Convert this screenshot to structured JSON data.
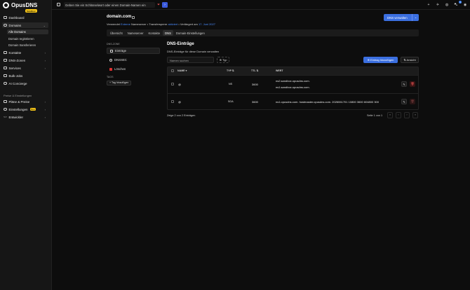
{
  "app": {
    "name": "OpusDNS",
    "env_badge": "Sandbox"
  },
  "topbar": {
    "search_placeholder": "Geben Sie ein Schlüsselwort oder einen Domain-Namen ein",
    "notification_count": "1"
  },
  "sidebar": {
    "items": [
      {
        "label": "Dashboard",
        "icon": "dashboard-icon"
      },
      {
        "label": "Domains",
        "icon": "globe-icon",
        "expanded": true
      },
      {
        "label": "Kontakte",
        "icon": "contacts-icon"
      },
      {
        "label": "DNS-Zonen",
        "icon": "dns-icon"
      },
      {
        "label": "Services",
        "icon": "services-icon"
      },
      {
        "label": "Bulk-Jobs",
        "icon": "bulk-icon"
      },
      {
        "label": "AI Concierge",
        "icon": "ai-icon"
      }
    ],
    "domain_sub": [
      "Alle Domains",
      "Domain registrieren",
      "Domain transferieren"
    ],
    "section_label": "Preise & Einstellungen",
    "bottom_items": [
      {
        "label": "Pläne & Preise",
        "icon": "plans-icon"
      },
      {
        "label": "Einstellungen",
        "icon": "settings-icon",
        "badge": "Neu"
      },
      {
        "label": "Entwickler",
        "icon": "code-icon"
      }
    ]
  },
  "domain": {
    "name": "domain.com",
    "meta_prefix": "Verwendet",
    "meta_link1": "Externe",
    "meta_mid": "Nameserver • Transfersperre",
    "meta_link2": "aktiviert",
    "meta_mid2": "• Verlängert am",
    "meta_date": "17. Juni 2027",
    "manage_button": "DNS verwalten"
  },
  "tabs": [
    "Übersicht",
    "Nameserver",
    "Kontakte",
    "DNS",
    "Domain-Einstellungen"
  ],
  "active_tab": "DNS",
  "dns_nav": {
    "label": "DNS-ZONE",
    "items": [
      "Einträge",
      "DNSSEC",
      "Löschen"
    ],
    "tags_label": "TAGS",
    "tag_button": "+ Tag hinzufügen"
  },
  "records": {
    "title": "DNS-Einträge",
    "description": "DNS-Einträge für diese Domain verwalten",
    "search_placeholder": "Namen suchen",
    "type_filter": "⊕ Typ",
    "add_button": "⊕ Eintrag hinzufügen",
    "view_button": "⇅ Ansicht",
    "columns": [
      "NAME ▾",
      "TYP ⇅",
      "TTL ⇅",
      "WERT"
    ],
    "rows": [
      {
        "name": "@",
        "type": "NS",
        "ttl": "3600",
        "values": [
          "ns2.sandbox.opusdns.com.",
          "ns1.sandbox.opusdns.com."
        ]
      },
      {
        "name": "@",
        "type": "SOA",
        "ttl": "3600",
        "values": [
          "ns1.opusdns.com. hostmaster.opusdns.com. 2026061701 10800 3600 604800 300"
        ]
      }
    ],
    "footer_count": "Zeige 2 von 2 Einträgen",
    "footer_page": "Seite 1 von 1",
    "pagination": [
      "«",
      "‹",
      "›",
      "»"
    ]
  },
  "colors": {
    "accent": "#3b6fe0",
    "badge": "#f5c518",
    "danger": "#e03131"
  }
}
